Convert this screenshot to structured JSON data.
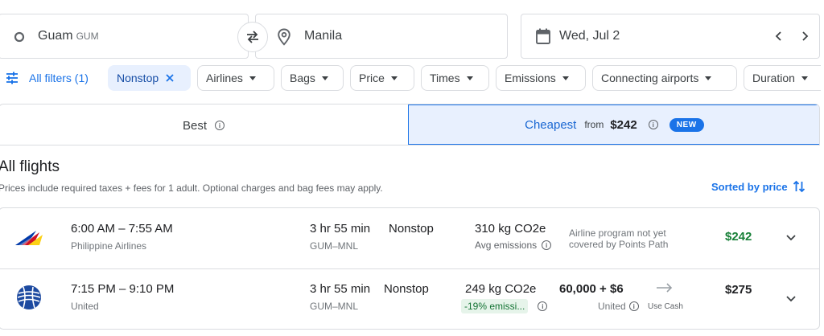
{
  "search": {
    "origin": {
      "city": "Guam",
      "code": "GUM"
    },
    "destination": "Manila",
    "date": "Wed, Jul 2"
  },
  "filters": {
    "all_filters": "All filters (1)",
    "chips": [
      "Nonstop",
      "Airlines",
      "Bags",
      "Price",
      "Times",
      "Emissions",
      "Connecting airports",
      "Duration"
    ]
  },
  "tabs": {
    "best": "Best",
    "cheapest": "Cheapest",
    "cheapest_from": "from",
    "cheapest_price": "$242",
    "new_badge": "NEW"
  },
  "section": {
    "title": "All flights",
    "note": "Prices include required taxes + fees for 1 adult. Optional charges and bag fees may apply.",
    "sort_label": "Sorted by price"
  },
  "flights": [
    {
      "times": "6:00 AM – 7:55 AM",
      "airline": "Philippine Airlines",
      "duration": "3 hr 55 min",
      "route": "GUM–MNL",
      "stops": "Nonstop",
      "co2": "310 kg CO2e",
      "emissions_note": "Avg emissions",
      "points_line1": "Airline program not yet",
      "points_line2": "covered by Points Path",
      "price": "$242",
      "price_color": "#188038"
    },
    {
      "times": "7:15 PM – 9:10 PM",
      "airline": "United",
      "duration": "3 hr 55 min",
      "route": "GUM–MNL",
      "stops": "Nonstop",
      "co2": "249 kg CO2e",
      "emissions_note": "-19% emissi...",
      "points_value": "60,000 + $6",
      "points_program": "United",
      "use_cash": "Use Cash",
      "price": "$275",
      "price_color": "#202124"
    }
  ],
  "colors": {
    "accent": "#1a73e8",
    "chip_selected_bg": "#e8f0fe",
    "green_price": "#188038",
    "emissions_pill_bg": "#e6f4ea"
  },
  "icons": [
    "origin-circle-icon",
    "swap-icon",
    "location-pin-icon",
    "calendar-icon",
    "chevron-left-icon",
    "chevron-right-icon",
    "filter-sliders-icon",
    "close-icon",
    "info-icon",
    "sort-arrows-icon",
    "chevron-down-icon",
    "philippine-airlines-logo",
    "united-logo",
    "arrow-right-icon"
  ]
}
